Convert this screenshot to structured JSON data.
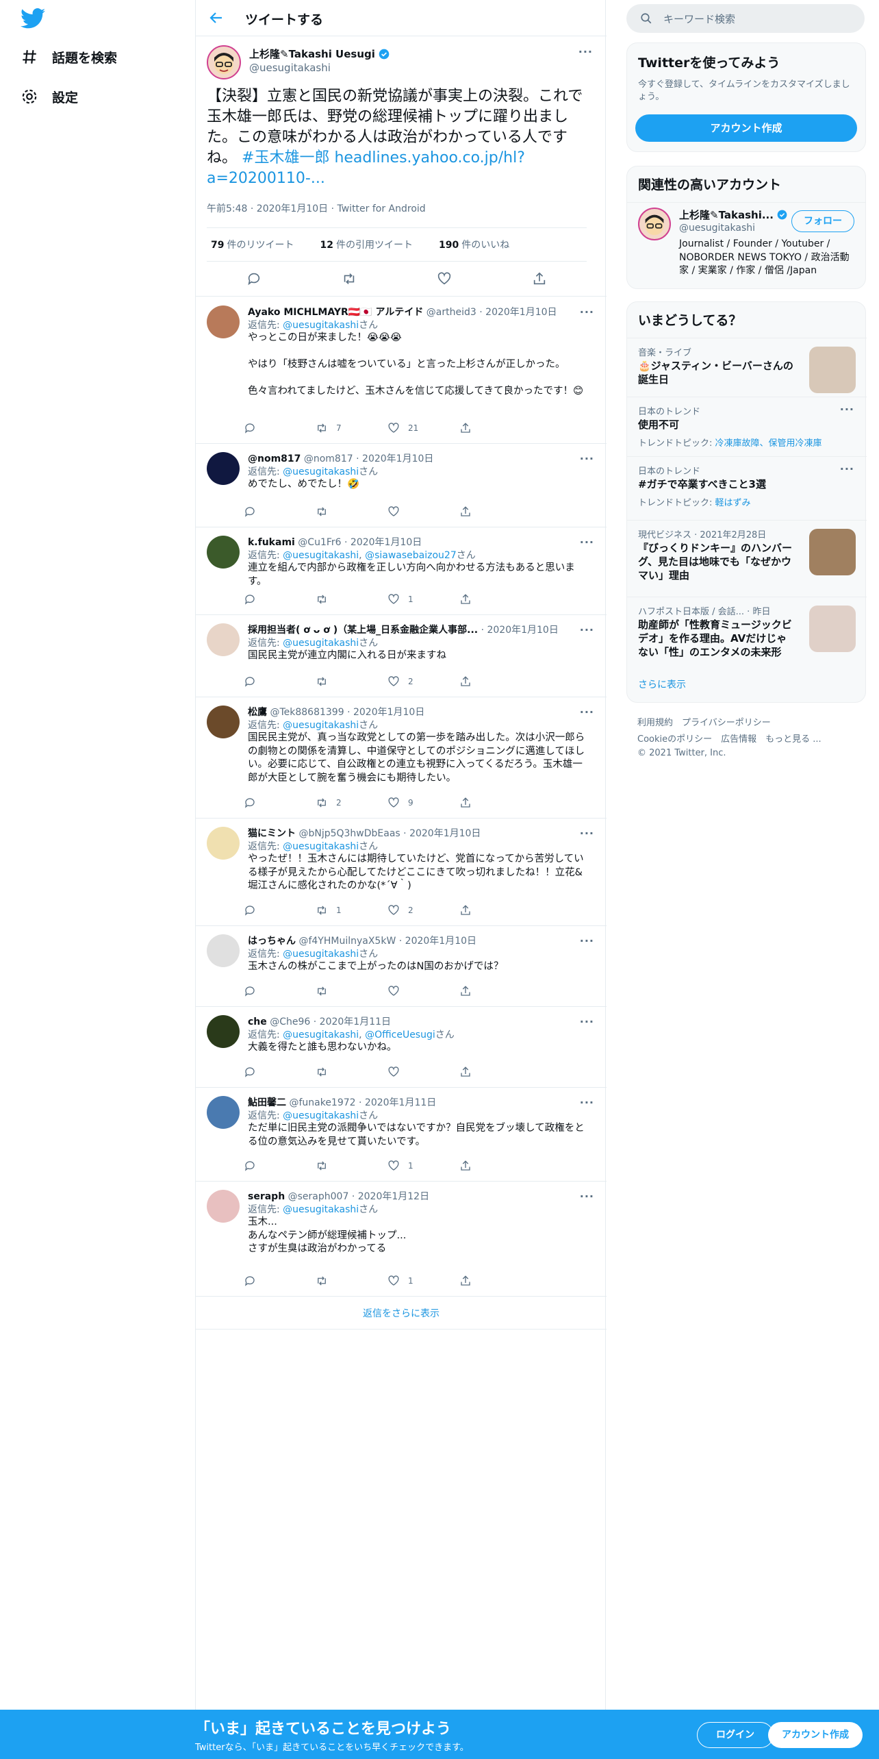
{
  "nav": {
    "explore": "話題を検索",
    "settings": "設定"
  },
  "header": {
    "title": "ツイートする"
  },
  "tweet": {
    "name": "上杉隆✎Takashi Uesugi",
    "handle": "@uesugitakashi",
    "text": "【決裂】立憲と国民の新党協議が事実上の決裂。これで玉木雄一郎氏は、野党の総理候補トップに躍り出ました。この意味がわかる人は政治がわかっている人ですね。",
    "hashtag": "#玉木雄一郎",
    "link": "headlines.yahoo.co.jp/hl?a=20200110-...",
    "meta": "午前5:48 · 2020年1月10日 · Twitter for Android",
    "retweets": "79",
    "retweets_label": "件のリツイート",
    "quotes": "12",
    "quotes_label": "件の引用ツイート",
    "likes": "190",
    "likes_label": "件のいいね"
  },
  "reply_to_label": "返信先:",
  "san": "さん",
  "replies": [
    {
      "name": "Ayako MICHLMAYR🇦🇹🇯🇵 アルテイド",
      "handle": "@artheid3",
      "date": "2020年1月10日",
      "to": [
        "@uesugitakashi"
      ],
      "lines": [
        "やっとこの日が来ました！😭😭😭",
        "",
        "やはり「枝野さんは嘘をついている」と言った上杉さんが正しかった。",
        "",
        "色々言われてましたけど、玉木さんを信じて応援してきて良かったです！😊"
      ],
      "rt": "7",
      "like": "21",
      "avcolor": "#b87a5a"
    },
    {
      "name": "@nom817",
      "handle": "@nom817",
      "date": "2020年1月10日",
      "to": [
        "@uesugitakashi"
      ],
      "lines": [
        "めでたし、めでたし！🤣"
      ],
      "rt": "",
      "like": "",
      "avcolor": "#101840"
    },
    {
      "name": "k.fukami",
      "handle": "@Cu1Fr6",
      "date": "2020年1月10日",
      "to": [
        "@uesugitakashi",
        "@siawasebaizou27"
      ],
      "lines": [
        "連立を組んで内部から政権を正しい方向へ向かわせる方法もあると思います。"
      ],
      "rt": "",
      "like": "1",
      "avcolor": "#3b5a2a"
    },
    {
      "name": "採用担当者( ơ ᴗ ơ )（某上場_日系金融企業人事部...",
      "handle": "",
      "date": "2020年1月10日",
      "to": [
        "@uesugitakashi"
      ],
      "lines": [
        "国民民主党が連立内閣に入れる日が来ますね"
      ],
      "rt": "",
      "like": "2",
      "avcolor": "#e8d5c8"
    },
    {
      "name": "松鷹",
      "handle": "@Tek88681399",
      "date": "2020年1月10日",
      "to": [
        "@uesugitakashi"
      ],
      "lines": [
        "国民民主党が、真っ当な政党としての第一歩を踏み出した。次は小沢一郎らの劇物との関係を清算し、中道保守としてのポジショニングに邁進してほしい。必要に応じて、自公政権との連立も視野に入ってくるだろう。玉木雄一郎が大臣として腕を奮う機会にも期待したい。"
      ],
      "rt": "2",
      "like": "9",
      "avcolor": "#6b4a2a"
    },
    {
      "name": "猫にミント",
      "handle": "@bNjp5Q3hwDbEaas",
      "date": "2020年1月10日",
      "to": [
        "@uesugitakashi"
      ],
      "lines": [
        "やったぜ！！玉木さんには期待していたけど、党首になってから苦労している様子が見えたから心配してたけどここにきて吹っ切れましたね！！立花&堀江さんに感化されたのかな(*´∀｀)"
      ],
      "rt": "1",
      "like": "2",
      "avcolor": "#f0e0b0"
    },
    {
      "name": "はっちゃん",
      "handle": "@f4YHMuilnyaX5kW",
      "date": "2020年1月10日",
      "to": [
        "@uesugitakashi"
      ],
      "lines": [
        "玉木さんの株がここまで上がったのはN国のおかげでは？"
      ],
      "rt": "",
      "like": "",
      "avcolor": "#e0e0e0"
    },
    {
      "name": "che",
      "handle": "@Che96",
      "date": "2020年1月11日",
      "to": [
        "@uesugitakashi",
        "@OfficeUesugi"
      ],
      "lines": [
        "大義を得たと誰も思わないかね。"
      ],
      "rt": "",
      "like": "",
      "avcolor": "#2a3a1a"
    },
    {
      "name": "鮎田馨二",
      "handle": "@funake1972",
      "date": "2020年1月11日",
      "to": [
        "@uesugitakashi"
      ],
      "lines": [
        "ただ単に旧民主党の派閥争いではないですか？自民党をブッ壊して政権をとる位の意気込みを見せて貰いたいです。"
      ],
      "rt": "",
      "like": "1",
      "avcolor": "#4a7ab0"
    },
    {
      "name": "seraph",
      "handle": "@seraph007",
      "date": "2020年1月12日",
      "to": [
        "@uesugitakashi"
      ],
      "lines": [
        "玉木...",
        "あんなペテン師が総理候補トップ...",
        "さすが生臭は政治がわかってる"
      ],
      "rt": "",
      "like": "1",
      "avcolor": "#e8c0c0"
    }
  ],
  "more_replies": "返信をさらに表示",
  "right": {
    "search_placeholder": "キーワード検索",
    "signup_title": "Twitterを使ってみよう",
    "signup_text": "今すぐ登録して、タイムラインをカスタマイズしましょう。",
    "signup_button": "アカウント作成",
    "related_title": "関連性の高いアカウント",
    "related_name": "上杉隆✎Takashi...",
    "related_handle": "@uesugitakashi",
    "follow": "フォロー",
    "related_bio": "Journalist / Founder / Youtuber / NOBORDER NEWS TOKYO / 政治活動家 / 実業家 / 作家 / 僧侶 /Japan",
    "trends_title": "いまどうしてる？",
    "trends": [
      {
        "sub": "音楽・ライブ",
        "main": "🎂ジャスティン・ビーバーさんの誕生日",
        "extra": ""
      },
      {
        "sub": "日本のトレンド",
        "main": "使用不可",
        "extra_label": "トレンドトピック:",
        "extra": "冷凍庫故障、保管用冷凍庫"
      },
      {
        "sub": "日本のトレンド",
        "main": "#ガチで卒業すべきこと3選",
        "extra_label": "トレンドトピック:",
        "extra": "軽はずみ"
      },
      {
        "sub": "現代ビジネス · 2021年2月28日",
        "main": "『びっくりドンキー』のハンバーグ、見た目は地味でも「なぜかウマい」理由",
        "extra": ""
      },
      {
        "sub": "ハフポスト日本版 / 会話... · 昨日",
        "main": "助産師が「性教育ミュージックビデオ」を作る理由。AVだけじゃない「性」のエンタメの未来形",
        "extra": ""
      }
    ],
    "show_more": "さらに表示",
    "footer1": "利用規約　プライバシーポリシー",
    "footer2": "Cookieのポリシー　広告情報　もっと見る ...",
    "footer3": "© 2021 Twitter, Inc."
  },
  "bottom": {
    "title": "「いま」起きていることを見つけよう",
    "sub": "Twitterなら、「いま」起きていることをいち早くチェックできます。",
    "login": "ログイン",
    "signup": "アカウント作成"
  }
}
